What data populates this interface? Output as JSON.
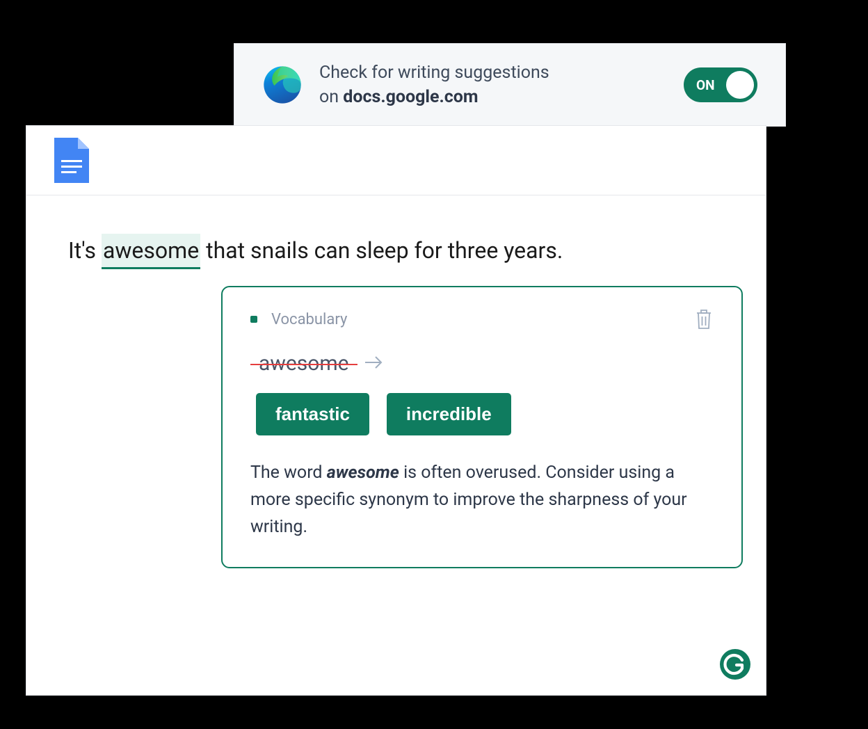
{
  "extension": {
    "text_line1": "Check for writing suggestions",
    "text_line2_prefix": "on ",
    "text_line2_domain": "docs.google.com",
    "toggle_label": "ON"
  },
  "document": {
    "sentence_prefix": "It's ",
    "highlighted_word": "awesome",
    "sentence_suffix": " that snails can sleep for three years."
  },
  "suggestion": {
    "category": "Vocabulary",
    "original_word": "awesome",
    "suggestions": [
      "fantastic",
      "incredible"
    ],
    "explanation_1": "The word ",
    "explanation_bold": "awesome",
    "explanation_2": " is often overused. Consider using a more specific synonym to improve the sharpness of your writing."
  }
}
